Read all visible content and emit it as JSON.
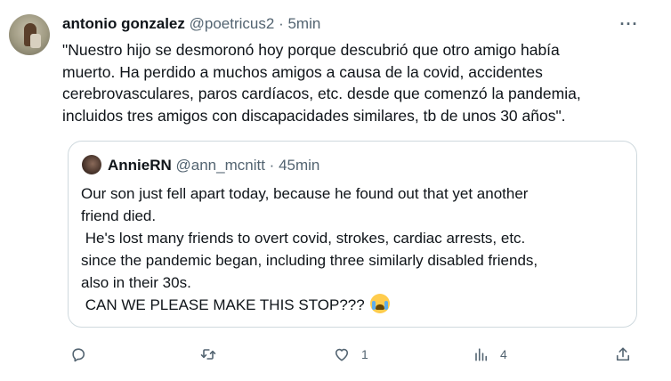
{
  "author": {
    "name": "antonio gonzalez",
    "handle": "@poetricus2",
    "separator": "·",
    "time": "5min"
  },
  "body_lines": [
    "\"Nuestro hijo se desmoronó hoy porque descubrió que otro amigo había",
    "muerto. Ha perdido a muchos amigos a causa de la covid, accidentes",
    "cerebrovasculares, paros cardíacos, etc. desde que comenzó la pandemia,",
    "incluidos tres amigos con discapacidades similares, tb de unos 30 años\"."
  ],
  "quote": {
    "author": {
      "name": "AnnieRN",
      "handle": "@ann_mcnitt",
      "separator": "·",
      "time": "45min"
    },
    "lines": [
      "Our son just fell apart today, because he found out that yet another",
      "friend died.",
      " He's lost many friends to overt covid, strokes, cardiac arrests, etc.",
      "since the pandemic began, including three similarly disabled friends,",
      "also in their 30s.",
      " CAN WE PLEASE MAKE THIS STOP??? "
    ],
    "emoji": "loudly-crying-face"
  },
  "actions": {
    "reply_icon": "reply-icon",
    "retweet_icon": "retweet-icon",
    "like_icon": "heart-icon",
    "like_count": "1",
    "views_icon": "views-icon",
    "views_count": "4",
    "share_icon": "share-icon"
  },
  "colors": {
    "text": "#0f1419",
    "secondary": "#536471",
    "border": "#cfd9de"
  }
}
